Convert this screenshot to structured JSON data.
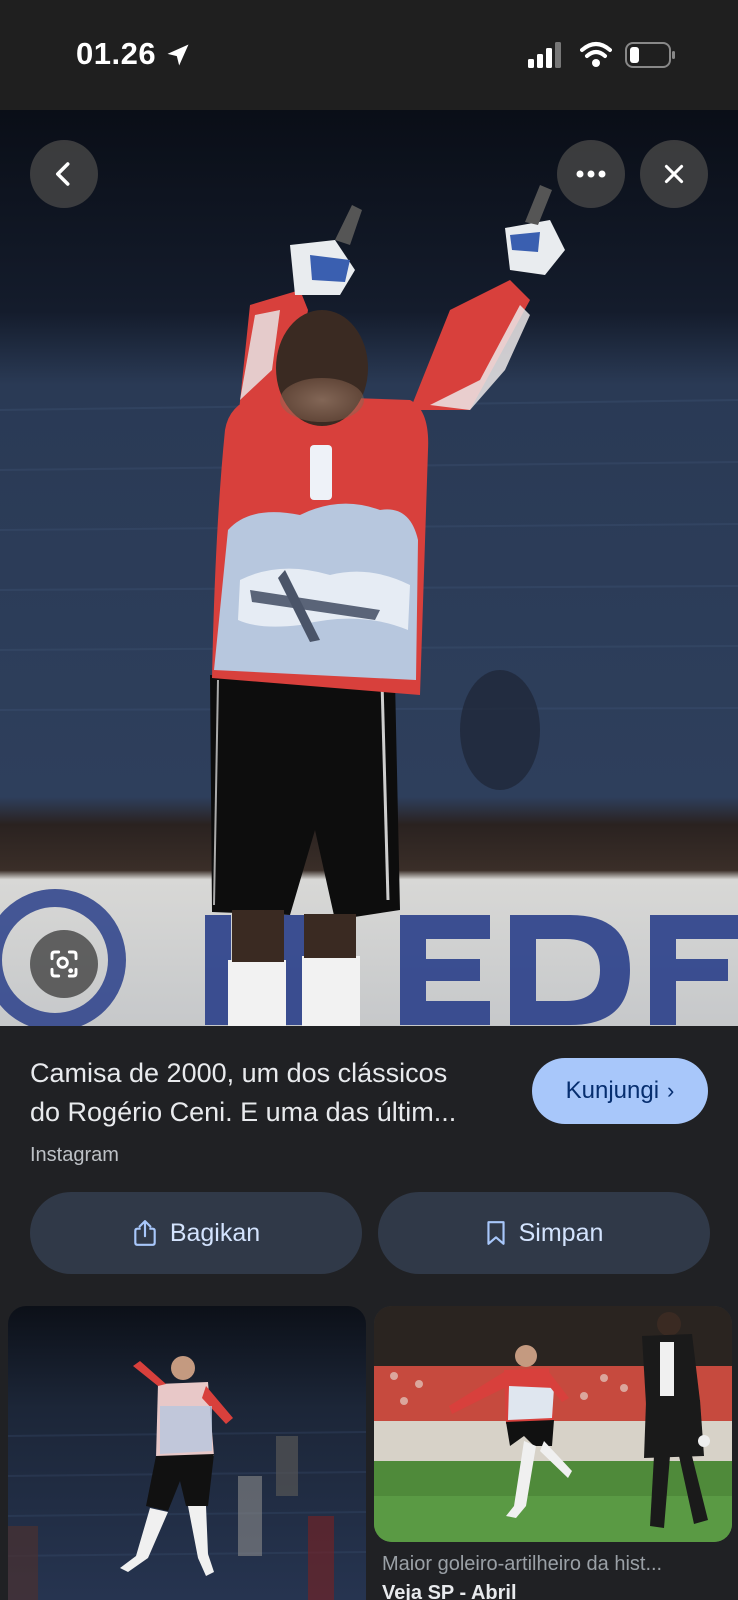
{
  "status_bar": {
    "time": "01.26"
  },
  "result": {
    "caption_line1": "Camisa de 2000, um dos clássicos",
    "caption_line2": "do Rogério Ceni. E uma das últim...",
    "source": "Instagram",
    "visit_label": "Kunjungi",
    "visit_chevron": "›"
  },
  "actions": {
    "share_label": "Bagikan",
    "save_label": "Simpan"
  },
  "related": [
    {
      "title": "",
      "source": ""
    },
    {
      "title": "Maior goleiro-artilheiro da hist...",
      "source": "Veja SP - Abril"
    }
  ],
  "colors": {
    "accent": "#a8c7fa",
    "button_bg": "#303948",
    "background": "#202124"
  }
}
